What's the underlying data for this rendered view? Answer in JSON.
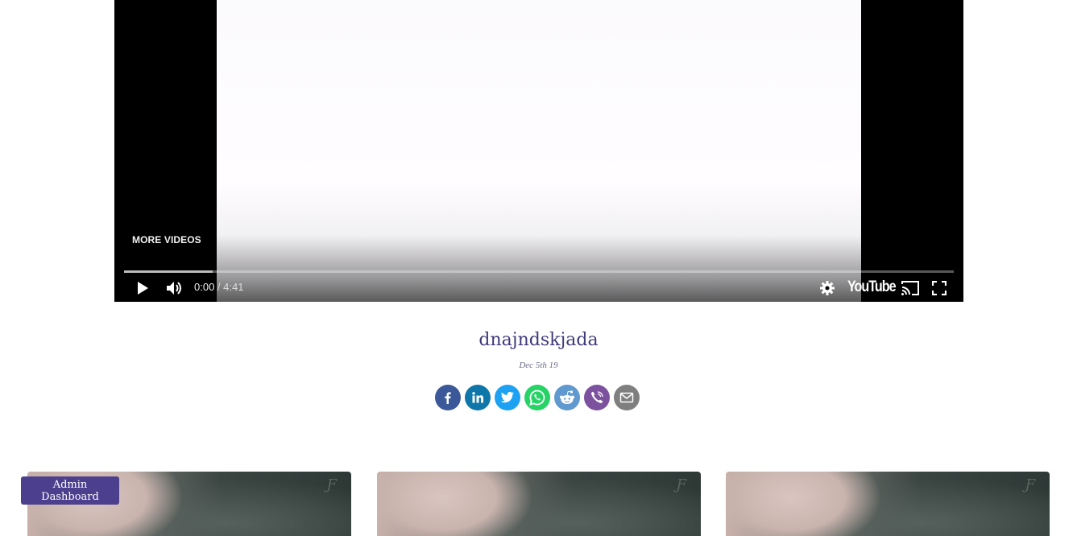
{
  "player": {
    "more_videos": "MORE VIDEOS",
    "time_current": "0:00",
    "time_separator": " / ",
    "time_duration": "4:41",
    "brand": "YouTube"
  },
  "post": {
    "title": "dnajndskjada",
    "date": "Dec 5th 19"
  },
  "share": [
    {
      "name": "facebook",
      "color": "#3b5998"
    },
    {
      "name": "linkedin",
      "color": "#0e76a8"
    },
    {
      "name": "twitter",
      "color": "#1da1f2"
    },
    {
      "name": "whatsapp",
      "color": "#25d366"
    },
    {
      "name": "reddit",
      "color": "#5f99cf"
    },
    {
      "name": "viber",
      "color": "#7c529e"
    },
    {
      "name": "email",
      "color": "#7f7f7f"
    }
  ],
  "admin": {
    "label": "Admin Dashboard",
    "color": "#4c3f8e"
  }
}
